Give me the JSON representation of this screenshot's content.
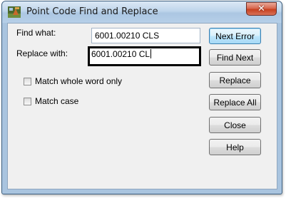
{
  "window": {
    "title": "Point Code Find and Replace",
    "close_icon": "close-x-icon"
  },
  "form": {
    "find_label": "Find what:",
    "find_value": "6001.00210 CLS",
    "replace_label": "Replace with:",
    "replace_value": "6001.00210 CL",
    "match_whole_word_label": "Match whole word only",
    "match_whole_word_checked": false,
    "match_case_label": "Match case",
    "match_case_checked": false
  },
  "buttons": {
    "next_error": "Next Error",
    "find_next": "Find Next",
    "replace": "Replace",
    "replace_all": "Replace All",
    "close": "Close",
    "help": "Help"
  }
}
